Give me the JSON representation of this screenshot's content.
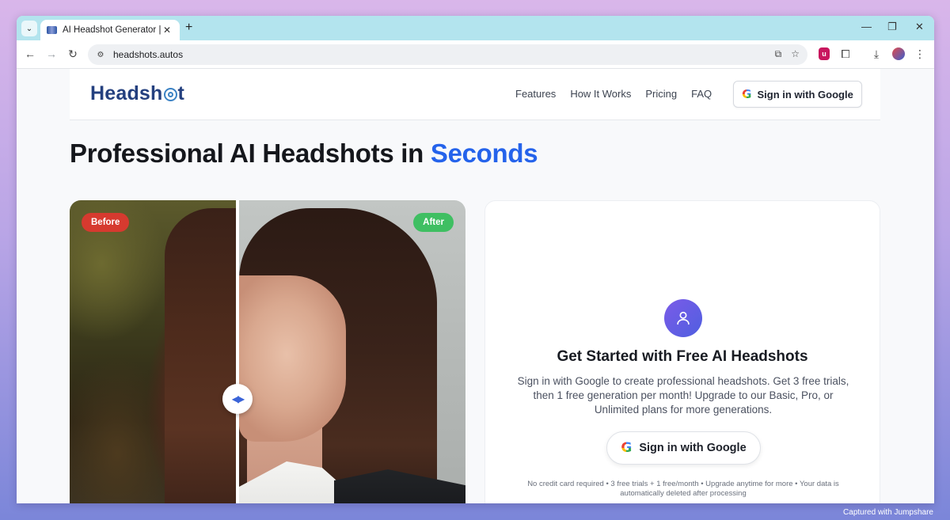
{
  "browser": {
    "tab_title": "AI Headshot Generator | Free Tr",
    "tab_close": "✕",
    "new_tab": "+",
    "url": "headshots.autos",
    "window_controls": {
      "minimize": "—",
      "restore": "❐",
      "close": "✕"
    },
    "nav_icons": {
      "back": "←",
      "forward": "→",
      "reload": "↻"
    },
    "extension_badge": "u"
  },
  "site": {
    "logo_part1": "Headsh",
    "logo_part2": "t",
    "nav": [
      {
        "label": "Features"
      },
      {
        "label": "How It Works"
      },
      {
        "label": "Pricing"
      },
      {
        "label": "FAQ"
      }
    ],
    "header_signin_label": "Sign in with Google",
    "google_glyph": "G"
  },
  "hero": {
    "title_main": "Professional AI Headshots in ",
    "title_accent": "Seconds",
    "accent_color": "#2563eb"
  },
  "compare": {
    "before_label": "Before",
    "after_label": "After",
    "handle_glyph": "◀▶",
    "before_color": "#d63a2f",
    "after_color": "#3fbf62"
  },
  "get_started": {
    "title": "Get Started with Free AI Headshots",
    "description": "Sign in with Google to create professional headshots. Get 3 free trials, then 1 free generation per month! Upgrade to our Basic, Pro, or Unlimited plans for more generations.",
    "button_label": "Sign in with Google",
    "note": "No credit card required • 3 free trials + 1 free/month • Upgrade anytime for more • Your data is automatically deleted after processing"
  },
  "watermark": "Captured with Jumpshare"
}
